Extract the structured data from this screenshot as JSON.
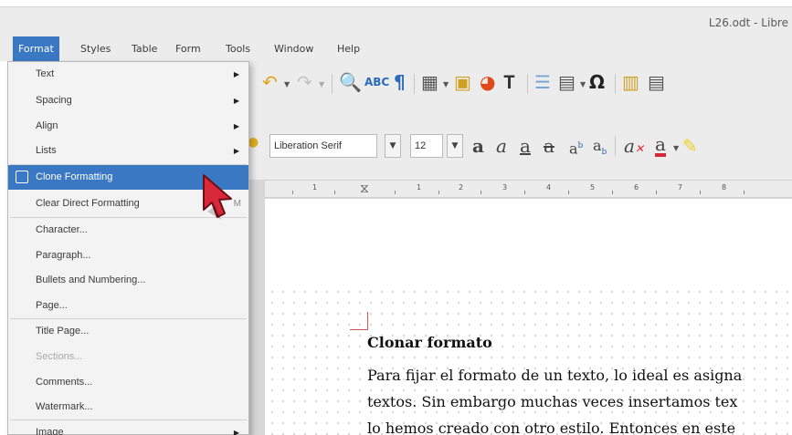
{
  "window": {
    "title": "L26.odt - Libre"
  },
  "menubar": {
    "items": [
      {
        "label": "Format",
        "active": true
      },
      {
        "label": "Styles"
      },
      {
        "label": "Table"
      },
      {
        "label": "Form"
      },
      {
        "label": "Tools"
      },
      {
        "label": "Window"
      },
      {
        "label": "Help"
      }
    ]
  },
  "format_menu": {
    "items": [
      {
        "label": "Text",
        "submenu": true
      },
      {
        "label": "Spacing",
        "submenu": true
      },
      {
        "label": "Align",
        "submenu": true
      },
      {
        "label": "Lists",
        "submenu": true
      },
      {
        "label": "Clone Formatting",
        "highlighted": true
      },
      {
        "label": "Clear Direct Formatting",
        "shortcut": "M"
      },
      {
        "label": "Character..."
      },
      {
        "label": "Paragraph..."
      },
      {
        "label": "Bullets and Numbering..."
      },
      {
        "label": "Page..."
      },
      {
        "label": "Title Page..."
      },
      {
        "label": "Sections...",
        "disabled": true
      },
      {
        "label": "Comments..."
      },
      {
        "label": "Watermark..."
      },
      {
        "label": "Image",
        "submenu": true
      }
    ]
  },
  "formatting_toolbar": {
    "font_name": "Liberation Serif",
    "font_size": "12"
  },
  "ruler": {
    "labels": [
      "1",
      "1",
      "2",
      "3",
      "4",
      "5",
      "6",
      "7",
      "8"
    ]
  },
  "document": {
    "heading": "Clonar formato",
    "lines": [
      "Para fijar el formato de un texto, lo ideal es asigna",
      "textos. Sin embargo muchas veces insertamos tex",
      "lo hemos creado con otro estilo. Entonces en este"
    ]
  },
  "colors": {
    "menu_highlight": "#3a78c4",
    "chrome": "#ececec",
    "cursor": "#d9283a"
  }
}
